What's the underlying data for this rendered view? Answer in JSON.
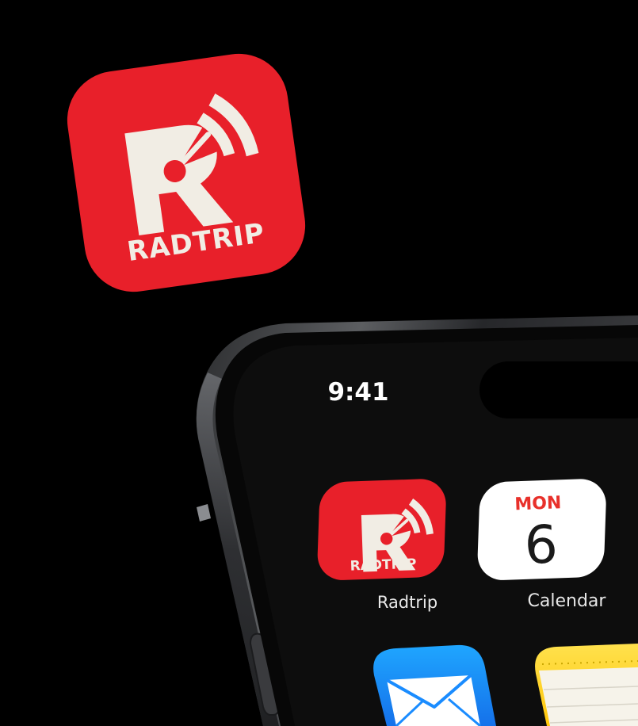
{
  "brand": {
    "wordmark": "RADTRIP",
    "color": "#e8202a",
    "mark_color": "#f1ede4"
  },
  "status_bar": {
    "time": "9:41"
  },
  "home_screen": {
    "apps": [
      {
        "name": "Radtrip",
        "icon": "radtrip-app-icon"
      },
      {
        "name": "Calendar",
        "icon": "calendar-app-icon",
        "weekday": "MON",
        "day": "6"
      },
      {
        "name": "",
        "icon": "mail-app-icon"
      },
      {
        "name": "",
        "icon": "notes-app-icon"
      }
    ]
  },
  "colors": {
    "background": "#000000",
    "screen": "#0b0b0b",
    "calendar_weekday": "#e8302a",
    "mail_blue": "#1a8cff",
    "notes_yellow": "#ffd60a"
  }
}
